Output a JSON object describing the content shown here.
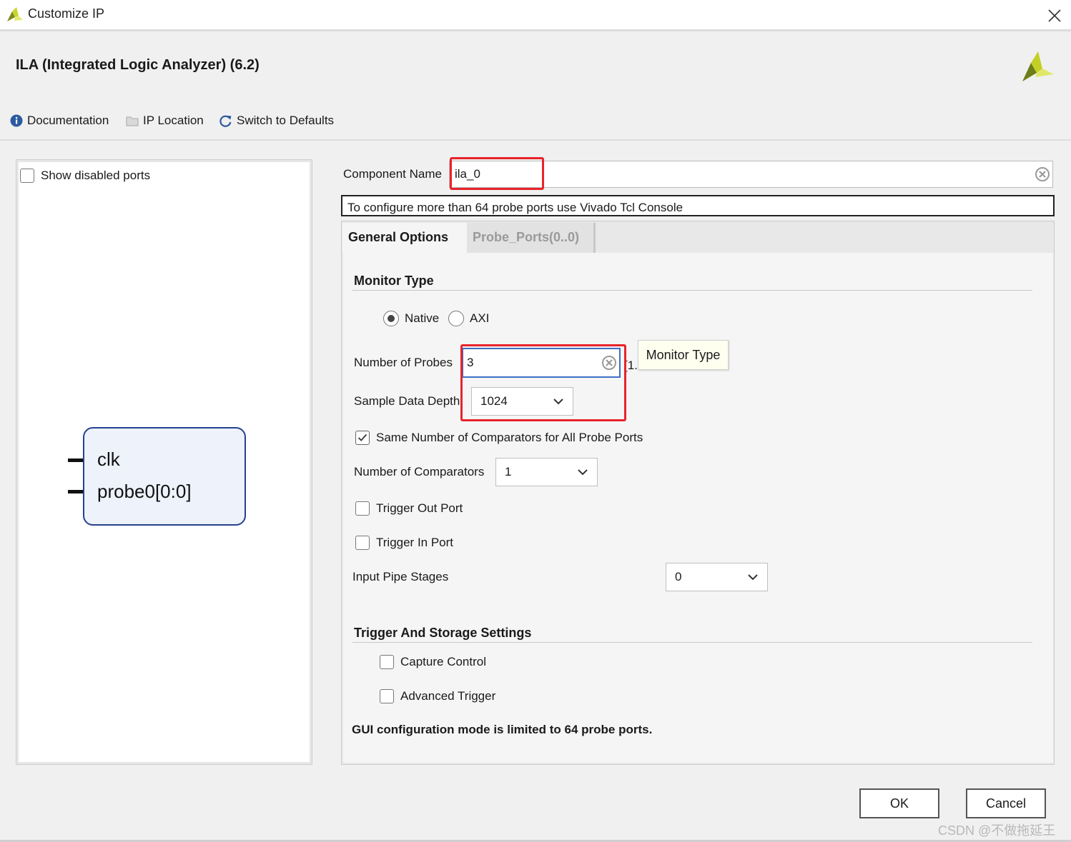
{
  "window": {
    "title": "Customize IP"
  },
  "header": {
    "ip_title": "ILA (Integrated Logic Analyzer) (6.2)"
  },
  "toolbar": {
    "documentation": "Documentation",
    "ip_location": "IP Location",
    "switch_defaults": "Switch to Defaults"
  },
  "left_panel": {
    "show_disabled_ports": "Show disabled ports",
    "show_disabled_checked": false,
    "symbol": {
      "ports": [
        "clk",
        "probe0[0:0]"
      ]
    }
  },
  "component": {
    "label": "Component Name",
    "value": "ila_0"
  },
  "info": {
    "text": "To configure more than 64 probe ports use Vivado Tcl Console"
  },
  "tabs": [
    {
      "label": "General Options",
      "active": true
    },
    {
      "label": "Probe_Ports(0..0)",
      "active": false
    }
  ],
  "general": {
    "monitor_type": {
      "title": "Monitor Type",
      "options": [
        "Native",
        "AXI"
      ],
      "selected": "Native",
      "tooltip": "Monitor Type"
    },
    "num_probes": {
      "label": "Number of Probes",
      "value": "3",
      "range_text": "[1..."
    },
    "sample_depth": {
      "label": "Sample Data Depth",
      "value": "1024"
    },
    "same_comparators": {
      "label": "Same Number of Comparators for All Probe Ports",
      "checked": true
    },
    "num_comparators": {
      "label": "Number of Comparators",
      "value": "1"
    },
    "trigger_out": {
      "label": "Trigger Out Port",
      "checked": false
    },
    "trigger_in": {
      "label": "Trigger In Port",
      "checked": false
    },
    "pipe_stages": {
      "label": "Input Pipe Stages",
      "value": "0"
    },
    "trigger_storage": {
      "title": "Trigger And Storage Settings",
      "capture_control": "Capture Control",
      "advanced_trigger": "Advanced Trigger"
    },
    "note": "GUI configuration mode is limited to 64 probe ports."
  },
  "buttons": {
    "ok": "OK",
    "cancel": "Cancel"
  },
  "watermark": "CSDN @不做拖延王",
  "colors": {
    "accent_blue": "#27418f",
    "highlight_red": "#e8232a",
    "symbol_fill": "#edf2fb"
  }
}
